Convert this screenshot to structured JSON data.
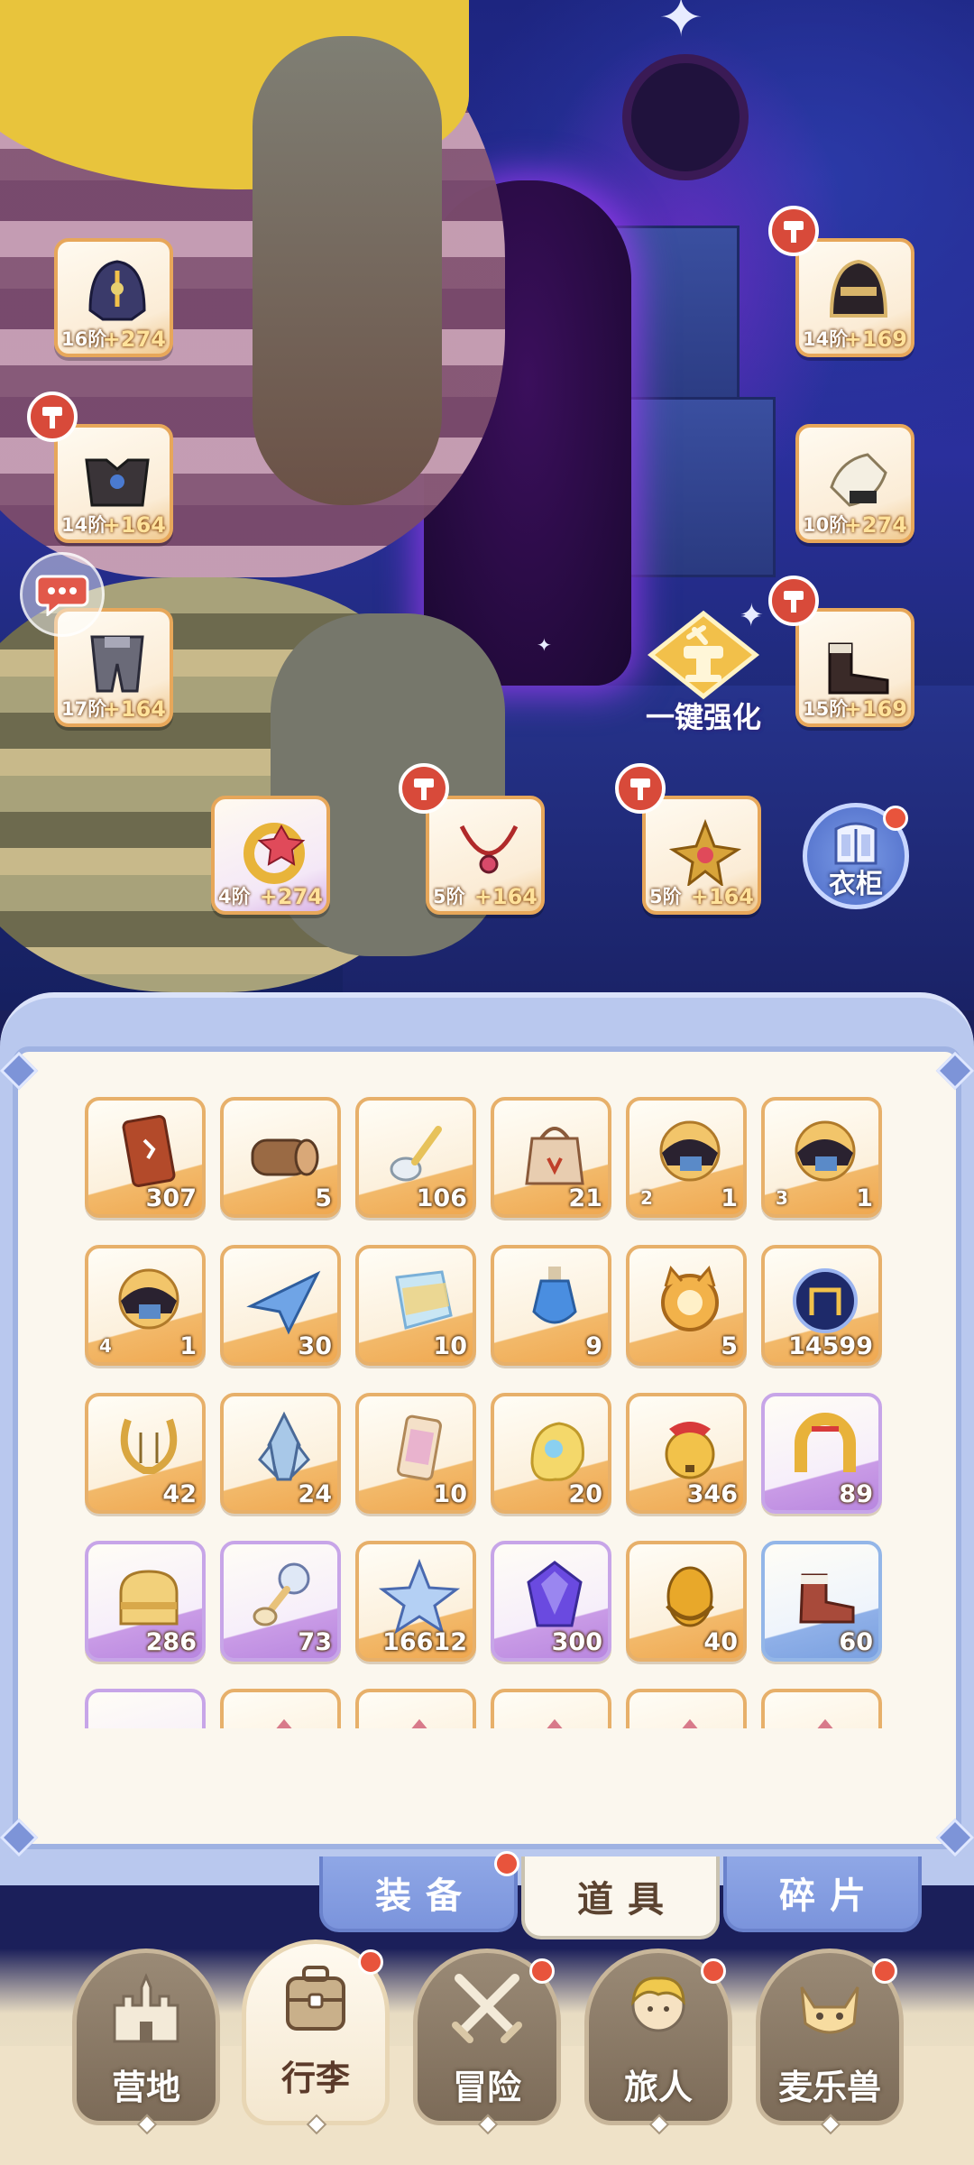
{
  "equipment": [
    {
      "grade": "16阶",
      "plus": "+274",
      "icon": "helmet-icon",
      "hammer": false,
      "frame": "orange"
    },
    {
      "grade": "14阶",
      "plus": "+164",
      "icon": "chest-armor-icon",
      "hammer": true,
      "frame": "orange"
    },
    {
      "grade": "17阶",
      "plus": "+164",
      "icon": "leg-armor-icon",
      "hammer": false,
      "frame": "orange"
    },
    {
      "grade": "14阶",
      "plus": "+169",
      "icon": "mask-helmet-icon",
      "hammer": true,
      "frame": "orange"
    },
    {
      "grade": "10阶",
      "plus": "+274",
      "icon": "gauntlet-icon",
      "hammer": false,
      "frame": "orange"
    },
    {
      "grade": "15阶",
      "plus": "+169",
      "icon": "boots-icon",
      "hammer": true,
      "frame": "orange"
    },
    {
      "grade": "4阶",
      "plus": "+274",
      "icon": "ring-icon",
      "hammer": false,
      "frame": "purple"
    },
    {
      "grade": "5阶",
      "plus": "+164",
      "icon": "necklace-icon",
      "hammer": true,
      "frame": "orange"
    },
    {
      "grade": "5阶",
      "plus": "+164",
      "icon": "charm-icon",
      "hammer": true,
      "frame": "orange"
    }
  ],
  "enhance_button": {
    "label": "一键强化",
    "icon": "anvil-icon"
  },
  "wardrobe_button": {
    "label": "衣柜",
    "icon": "wardrobe-icon"
  },
  "chat_icon": "chat-bubble-icon",
  "inventory": {
    "rows": [
      [
        {
          "icon": "card-icon",
          "count": "307",
          "frame": "orange"
        },
        {
          "icon": "wood-log-icon",
          "count": "5",
          "frame": "orange"
        },
        {
          "icon": "spoon-icon",
          "count": "106",
          "frame": "orange"
        },
        {
          "icon": "bag-icon",
          "count": "21",
          "frame": "orange"
        },
        {
          "icon": "saddle-icon",
          "count": "1",
          "tier": "2",
          "frame": "orange"
        },
        {
          "icon": "saddle-icon",
          "count": "1",
          "tier": "3",
          "frame": "orange"
        }
      ],
      [
        {
          "icon": "saddle-icon",
          "count": "1",
          "tier": "4",
          "frame": "orange"
        },
        {
          "icon": "paper-plane-icon",
          "count": "30",
          "frame": "orange"
        },
        {
          "icon": "rainbow-crystal-icon",
          "count": "10",
          "frame": "orange"
        },
        {
          "icon": "potion-icon",
          "count": "9",
          "frame": "orange"
        },
        {
          "icon": "cat-coin-icon",
          "count": "5",
          "frame": "orange"
        },
        {
          "icon": "orb-icon",
          "count": "14599",
          "frame": "orange"
        }
      ],
      [
        {
          "icon": "lyre-icon",
          "count": "42",
          "frame": "orange"
        },
        {
          "icon": "ice-crystal-icon",
          "count": "24",
          "frame": "orange"
        },
        {
          "icon": "paint-tube-icon",
          "count": "10",
          "frame": "orange"
        },
        {
          "icon": "paint-splash-icon",
          "count": "20",
          "frame": "orange"
        },
        {
          "icon": "bell-icon",
          "count": "346",
          "frame": "orange"
        },
        {
          "icon": "horseshoe-icon",
          "count": "89",
          "frame": "purple"
        }
      ],
      [
        {
          "icon": "toast-icon",
          "count": "286",
          "frame": "purple"
        },
        {
          "icon": "cat-spoon-icon",
          "count": "73",
          "frame": "purple"
        },
        {
          "icon": "star-crystal-icon",
          "count": "16612",
          "frame": "orange"
        },
        {
          "icon": "purple-gem-icon",
          "count": "300",
          "frame": "purple"
        },
        {
          "icon": "amber-icon",
          "count": "40",
          "frame": "orange"
        },
        {
          "icon": "boot-icon",
          "count": "60",
          "frame": "blue"
        }
      ],
      [
        {
          "icon": "coin-icon",
          "count": "",
          "frame": "purple"
        },
        {
          "icon": "shard-icon",
          "count": "",
          "frame": "orange"
        },
        {
          "icon": "shard-icon",
          "count": "",
          "frame": "orange"
        },
        {
          "icon": "shard-icon",
          "count": "",
          "frame": "orange"
        },
        {
          "icon": "shard-icon",
          "count": "",
          "frame": "orange"
        },
        {
          "icon": "shard-icon",
          "count": "",
          "frame": "orange"
        }
      ]
    ]
  },
  "tabs": [
    {
      "label": "装备",
      "active": false,
      "badge": true
    },
    {
      "label": "道具",
      "active": true,
      "badge": false
    },
    {
      "label": "碎片",
      "active": false,
      "badge": false
    }
  ],
  "nav": [
    {
      "label": "营地",
      "icon": "castle-icon",
      "active": false,
      "badge": false
    },
    {
      "label": "行李",
      "icon": "luggage-icon",
      "active": true,
      "badge": true
    },
    {
      "label": "冒险",
      "icon": "crossed-swords-icon",
      "active": false,
      "badge": true
    },
    {
      "label": "旅人",
      "icon": "traveler-icon",
      "active": false,
      "badge": true
    },
    {
      "label": "麦乐兽",
      "icon": "pet-icon",
      "active": false,
      "badge": true
    }
  ],
  "colors": {
    "accent_orange": "#e7a75a",
    "badge_red": "#e8543c",
    "panel_blue": "#9fb2e2",
    "panel_cream": "#fbf7ee"
  }
}
